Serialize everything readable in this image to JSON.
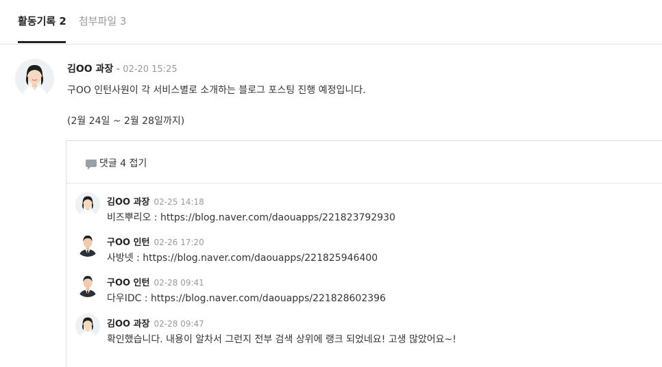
{
  "tabs": {
    "activity": "활동기록 2",
    "attachments": "첨부파일 3"
  },
  "post": {
    "author": "김OO 과장",
    "separator": "-",
    "time": "02-20 15:25",
    "body_line1": "구OO 인턴사원이 각 서비스별로 소개하는 블로그 포스팅 진행 예정입니다.",
    "body_line2": "(2월 24일 ~ 2월 28일까지)"
  },
  "comments_header": {
    "icon": "comment-bubble-icon",
    "label": "댓글 4 접기"
  },
  "comments": [
    {
      "author": "김OO 과장",
      "time": "02-25 14:18",
      "text": "비즈뿌리오 : https://blog.naver.com/daouapps/221823792930",
      "avatar": "female"
    },
    {
      "author": "구OO 인턴",
      "time": "02-26 17:20",
      "text": "사방넷 : https://blog.naver.com/daouapps/221825946400",
      "avatar": "male"
    },
    {
      "author": "구OO 인턴",
      "time": "02-28 09:41",
      "text": "다우IDC : https://blog.naver.com/daouapps/221828602396",
      "avatar": "male"
    },
    {
      "author": "김OO 과장",
      "time": "02-28 09:47",
      "text": "확인했습니다.  내용이 알차서 그런지 전부 검색 상위에 랭크 되었네요! 고생 많았어요~!",
      "avatar": "female"
    }
  ]
}
